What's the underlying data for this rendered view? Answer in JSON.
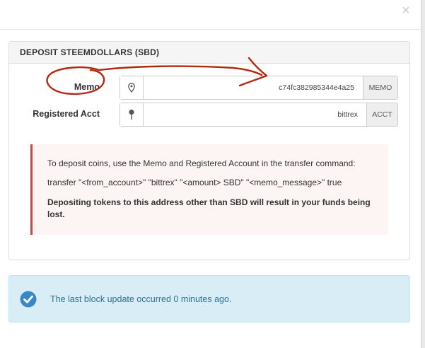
{
  "modal": {
    "close_glyph": "×"
  },
  "panel": {
    "title": "DEPOSIT STEEMDOLLARS (SBD)"
  },
  "memo": {
    "label": "Memo",
    "value": "c74fc382985344e4a25",
    "addon": "MEMO",
    "icon": "map-marker-icon"
  },
  "account": {
    "label": "Registered Acct",
    "value": "bittrex",
    "addon": "ACCT",
    "icon": "pushpin-icon"
  },
  "alert": {
    "line1": "To deposit coins, use the Memo and Registered Account in the transfer command:",
    "line2": "transfer \"<from_account>\" \"bittrex\" \"<amount> SBD\" \"<memo_message>\" true",
    "warning": "Depositing tokens to this address other than SBD will result in your funds being lost.",
    "accent_color": "#c9493f"
  },
  "info": {
    "text": "The last block update occurred 0 minutes ago.",
    "icon": "check-circle-icon"
  },
  "colors": {
    "info_bg": "#d9edf7",
    "info_text": "#31708f",
    "annotation": "#b22a12"
  }
}
